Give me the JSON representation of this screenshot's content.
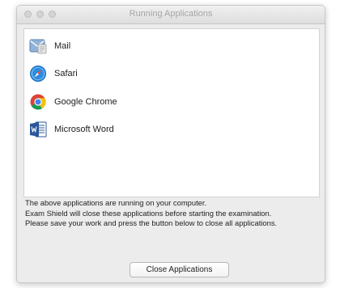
{
  "window": {
    "title": "Running Applications"
  },
  "apps": [
    {
      "label": "Mail",
      "icon": "mail-icon"
    },
    {
      "label": "Safari",
      "icon": "safari-icon"
    },
    {
      "label": "Google Chrome",
      "icon": "chrome-icon"
    },
    {
      "label": "Microsoft Word",
      "icon": "word-icon"
    }
  ],
  "message": {
    "line1": "The above applications are running on your computer.",
    "line2": "Exam Shield will close these applications before starting the examination.",
    "line3": "Please save your work and press the button below to close all applications."
  },
  "button": {
    "close_label": "Close Applications"
  },
  "colors": {
    "window_bg": "#ececec",
    "list_bg": "#ffffff",
    "safari_blue": "#2a8ce0",
    "chrome_red": "#db4437",
    "chrome_yellow": "#f4c20d",
    "chrome_green": "#0f9d58",
    "chrome_blue": "#4285f4",
    "word_blue": "#2b579a"
  }
}
